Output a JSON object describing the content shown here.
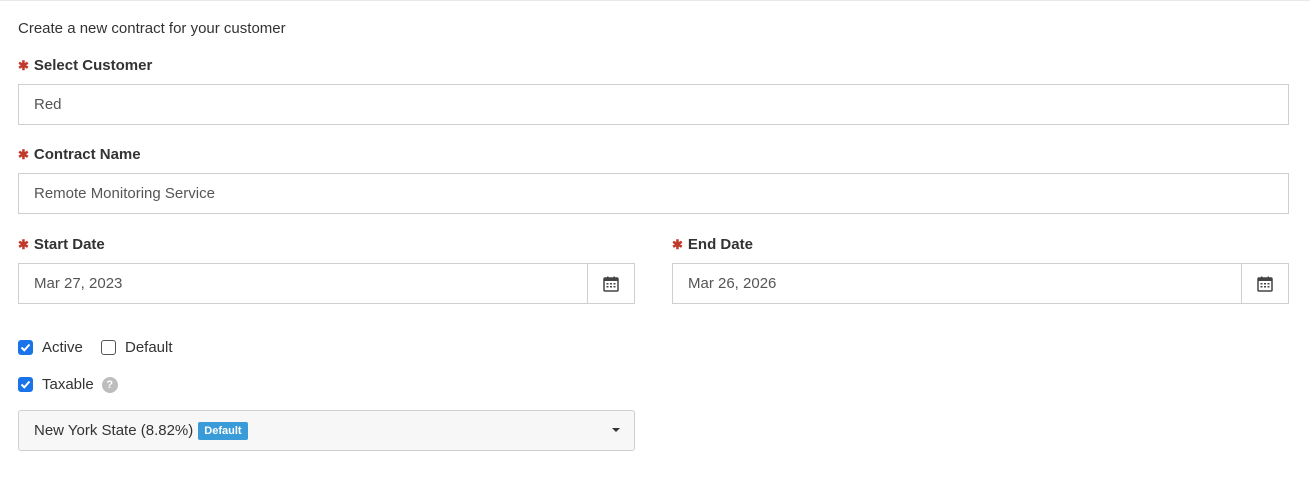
{
  "intro": "Create a new contract for your customer",
  "required_marker": "✱",
  "customer": {
    "label": "Select Customer",
    "value": "Red"
  },
  "contract_name": {
    "label": "Contract Name",
    "value": "Remote Monitoring Service"
  },
  "start_date": {
    "label": "Start Date",
    "value": "Mar 27, 2023",
    "icon": "calendar-icon"
  },
  "end_date": {
    "label": "End Date",
    "value": "Mar 26, 2026",
    "icon": "calendar-icon"
  },
  "checkboxes": {
    "active": {
      "label": "Active",
      "checked": true
    },
    "default": {
      "label": "Default",
      "checked": false
    },
    "taxable": {
      "label": "Taxable",
      "checked": true,
      "help": "?"
    }
  },
  "tax_select": {
    "value": "New York State (8.82%)",
    "badge": "Default"
  },
  "colors": {
    "accent": "#1a73e8",
    "required": "#c0392b",
    "badge": "#3a9bd9"
  }
}
